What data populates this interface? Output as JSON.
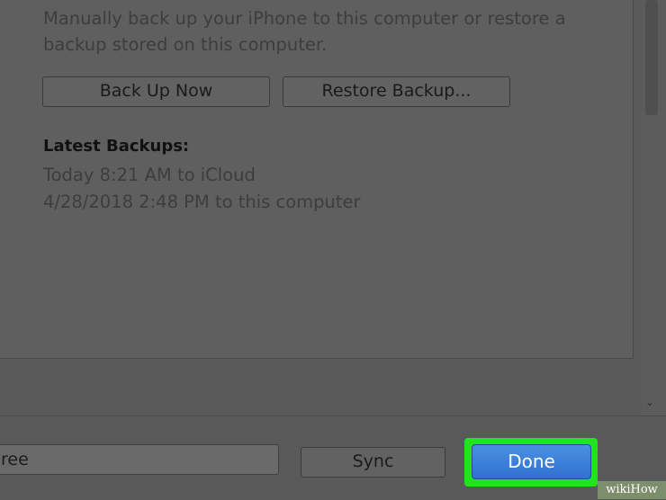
{
  "backups": {
    "description": "Manually back up your iPhone to this computer or restore a backup stored on this computer.",
    "back_up_now_label": "Back Up Now",
    "restore_backup_label": "Restore Backup...",
    "latest_heading": "Latest Backups:",
    "latest": [
      "Today 8:21 AM to iCloud",
      "4/28/2018 2:48 PM to this computer"
    ]
  },
  "footer": {
    "storage_label": "ree",
    "sync_label": "Sync",
    "done_label": "Done"
  },
  "watermark": "wikiHow",
  "colors": {
    "highlight": "#21e41d",
    "done_button": "#3b82db"
  }
}
